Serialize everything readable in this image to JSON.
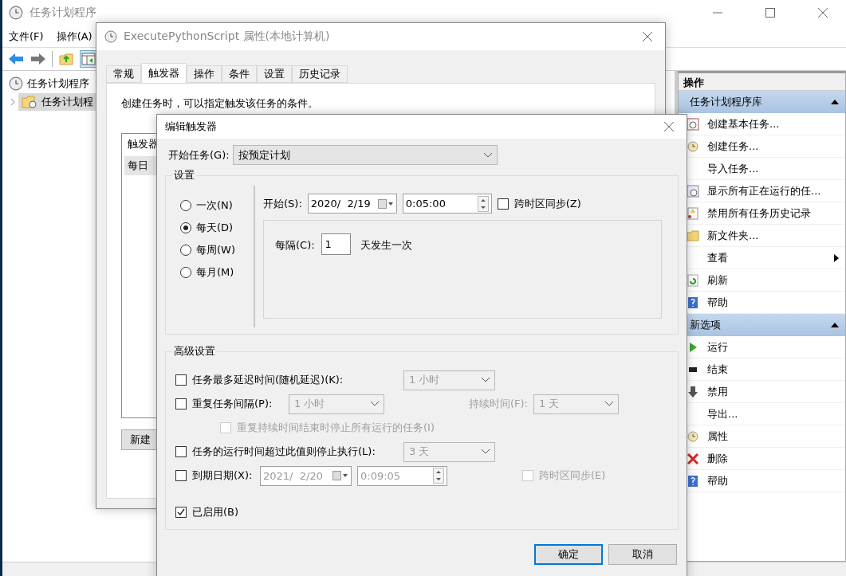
{
  "main_window": {
    "title": "任务计划程序",
    "menu": [
      "文件(F)",
      "操作(A)"
    ],
    "tree": [
      {
        "label": "任务计划程序",
        "selected": false,
        "children": [
          {
            "label": "任务计划程",
            "selected": true
          }
        ]
      }
    ],
    "actions_pane": {
      "header": "操作",
      "sections": [
        {
          "title": "任务计划程序库",
          "expanded": true,
          "items": [
            {
              "label": "创建基本任务...",
              "kind": "calendar"
            },
            {
              "label": "创建任务...",
              "kind": "clock"
            },
            {
              "label": "导入任务...",
              "kind": "plain"
            },
            {
              "label": "显示所有正在运行的任...",
              "kind": "window"
            },
            {
              "label": "禁用所有任务历史记录",
              "kind": "log"
            },
            {
              "label": "新文件夹...",
              "kind": "folder"
            },
            {
              "label": "查看",
              "kind": "plain",
              "submenu": true
            },
            {
              "label": "刷新",
              "kind": "refresh"
            },
            {
              "label": "帮助",
              "kind": "help"
            }
          ]
        },
        {
          "title": "新选项",
          "expanded": true,
          "items": [
            {
              "label": "运行",
              "kind": "play"
            },
            {
              "label": "结束",
              "kind": "stop"
            },
            {
              "label": "禁用",
              "kind": "down"
            },
            {
              "label": "导出...",
              "kind": "plain"
            },
            {
              "label": "属性",
              "kind": "clock"
            },
            {
              "label": "删除",
              "kind": "delete"
            },
            {
              "label": "帮助",
              "kind": "help"
            }
          ]
        }
      ]
    }
  },
  "properties_dialog": {
    "title": "ExecutePythonScript 属性(本地计算机)",
    "tabs": [
      {
        "label": "常规",
        "selected": false
      },
      {
        "label": "触发器",
        "selected": true
      },
      {
        "label": "操作",
        "selected": false
      },
      {
        "label": "条件",
        "selected": false
      },
      {
        "label": "设置",
        "selected": false
      },
      {
        "label": "历史记录",
        "selected": false
      }
    ],
    "description": "创建任务时，可以指定触发该任务的条件。",
    "list_column": "触发器",
    "list_rows": [
      {
        "label": "每日",
        "selected": true
      }
    ],
    "new_button": "新建"
  },
  "trigger_dialog": {
    "title": "编辑触发器",
    "begin_label": "开始任务(G):",
    "begin_value": "按预定计划",
    "settings_title": "设置",
    "schedules": [
      {
        "label": "一次(N)",
        "selected": false
      },
      {
        "label": "每天(D)",
        "selected": true
      },
      {
        "label": "每周(W)",
        "selected": false
      },
      {
        "label": "每月(M)",
        "selected": false
      }
    ],
    "start_label": "开始(S):",
    "start_date": "2020/  2/19",
    "start_time": "0:05:00",
    "sync": {
      "label": "跨时区同步(Z)",
      "checked": false
    },
    "recur_label": "每隔(C):",
    "recur_value": "1",
    "recur_suffix": "天发生一次",
    "advanced_title": "高级设置",
    "advanced": [
      {
        "kind": "select",
        "label": "任务最多延迟时间(随机延迟)(K):",
        "checked": false,
        "value": "1 小时"
      },
      {
        "kind": "repeat",
        "label": "重复任务间隔(P):",
        "checked": false,
        "value": "1 小时",
        "duration_label": "持续时间(F):",
        "duration_value": "1 天"
      },
      {
        "kind": "sub",
        "label": "重复持续时间结束时停止所有运行的任务(I)",
        "checked": false,
        "disabled": true
      },
      {
        "kind": "select",
        "label": "任务的运行时间超过此值则停止执行(L):",
        "checked": false,
        "value": "3 天"
      },
      {
        "kind": "expire",
        "label": "到期日期(X):",
        "checked": false,
        "date": "2021/  2/20",
        "time": "0:09:05",
        "sync_label": "跨时区同步(E)",
        "sync_checked": false
      },
      {
        "kind": "enabled",
        "label": "已启用(B)",
        "checked": true
      }
    ],
    "buttons": [
      {
        "label": "确定",
        "default": true
      },
      {
        "label": "取消",
        "default": false
      }
    ]
  }
}
